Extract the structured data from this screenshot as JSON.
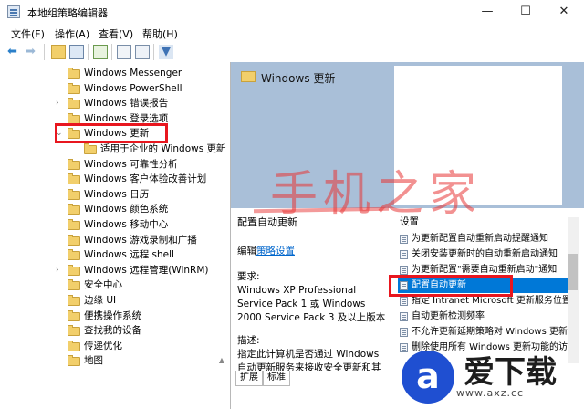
{
  "window": {
    "title": "本地组策略编辑器",
    "controls": {
      "minimize": "—",
      "maximize": "☐",
      "close": "✕"
    }
  },
  "menu": [
    "文件(F)",
    "操作(A)",
    "查看(V)",
    "帮助(H)"
  ],
  "toolbar": {
    "icons": [
      "back-icon",
      "forward-icon",
      "folder-up-icon",
      "show-hide-tree-icon",
      "export-list-icon",
      "properties-icon",
      "help-icon",
      "filter-icon"
    ]
  },
  "tree": {
    "items": [
      {
        "label": "Windows Messenger",
        "expandable": false
      },
      {
        "label": "Windows PowerShell",
        "expandable": false
      },
      {
        "label": "Windows 错误报告",
        "expandable": true
      },
      {
        "label": "Windows 登录选项",
        "expandable": false
      },
      {
        "label": "Windows 更新",
        "expandable": true,
        "expanded": true,
        "selected": true
      },
      {
        "label": "适用于企业的 Windows 更新",
        "expandable": false,
        "child": true
      },
      {
        "label": "Windows 可靠性分析",
        "expandable": false
      },
      {
        "label": "Windows 客户体验改善计划",
        "expandable": false
      },
      {
        "label": "Windows 日历",
        "expandable": false
      },
      {
        "label": "Windows 颜色系统",
        "expandable": false
      },
      {
        "label": "Windows 移动中心",
        "expandable": false
      },
      {
        "label": "Windows 游戏录制和广播",
        "expandable": false
      },
      {
        "label": "Windows 远程 shell",
        "expandable": false
      },
      {
        "label": "Windows 远程管理(WinRM)",
        "expandable": true
      },
      {
        "label": "安全中心",
        "expandable": false
      },
      {
        "label": "边缘 UI",
        "expandable": false
      },
      {
        "label": "便携操作系统",
        "expandable": false
      },
      {
        "label": "查找我的设备",
        "expandable": false
      },
      {
        "label": "传递优化",
        "expandable": false
      },
      {
        "label": "地图",
        "expandable": false
      }
    ]
  },
  "right": {
    "header_title": "Windows 更新",
    "setting_title": "配置自动更新",
    "edit_prefix": "编辑",
    "edit_link": "策略设置",
    "requirements_label": "要求:",
    "requirements_lines": [
      "Windows XP Professional",
      "Service Pack 1 或 Windows",
      "2000 Service Pack 3 及以上版本"
    ],
    "description_label": "描述:",
    "description_lines": [
      "指定此计算机是否通过 Windows",
      "自动更新服务来接收安全更新和其"
    ],
    "settings_header": "设置",
    "settings": [
      {
        "label": "为更新配置自动重新启动提醒通知",
        "selected": false
      },
      {
        "label": "关闭安装更新时的自动重新启动通知",
        "selected": false
      },
      {
        "label": "为更新配置\"需要自动重新启动\"通知",
        "selected": false
      },
      {
        "label": "配置自动更新",
        "selected": true
      },
      {
        "label": "指定 Intranet Microsoft 更新服务位置",
        "selected": false
      },
      {
        "label": "自动更新检测频率",
        "selected": false
      },
      {
        "label": "不允许更新延期策略对 Windows 更新",
        "selected": false
      },
      {
        "label": "删除使用所有 Windows 更新功能的访",
        "selected": false
      }
    ],
    "tabs": [
      "扩展",
      "标准"
    ]
  },
  "watermark": {
    "text": "手机之家"
  },
  "logo": {
    "glyph": "a",
    "name": "爱下载",
    "url": "www.axz.cc"
  },
  "colors": {
    "highlight": "#e8171f",
    "selection": "#0078d7",
    "header_band": "#a9bfd8",
    "logo_blue": "#1f4fd1"
  }
}
